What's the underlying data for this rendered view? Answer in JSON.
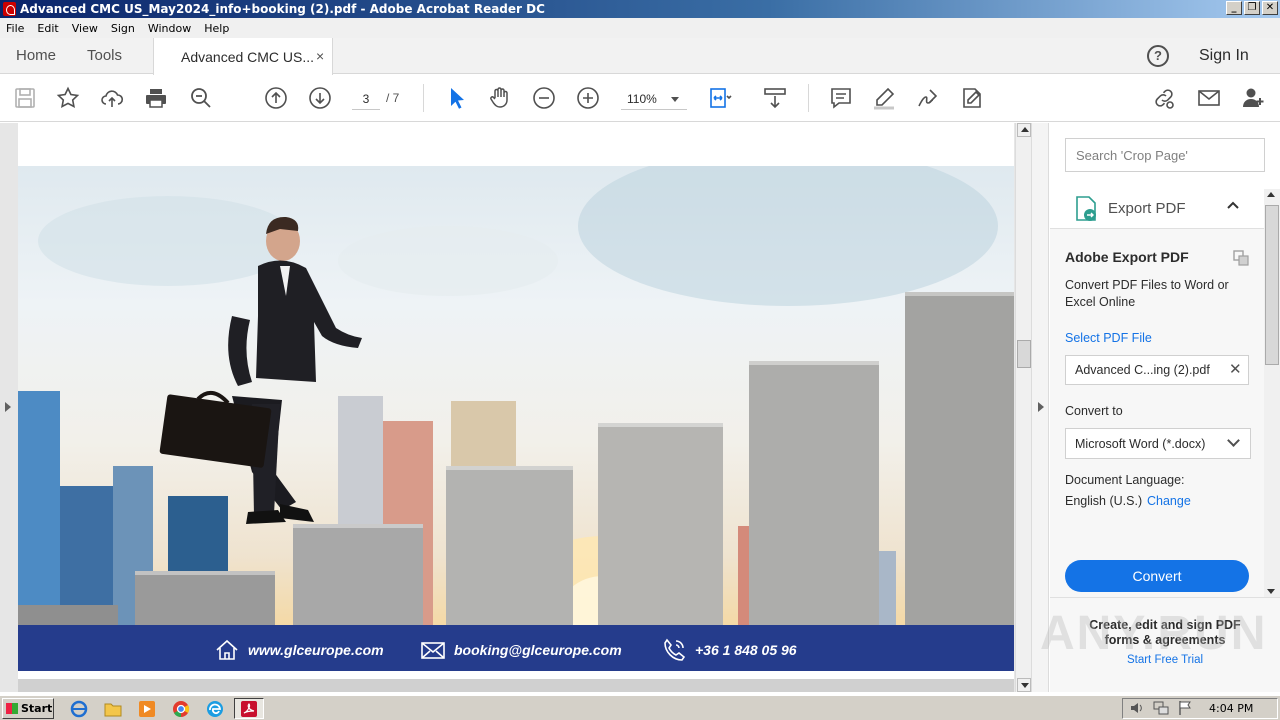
{
  "window": {
    "title": "Advanced CMC US_May2024_info+booking (2).pdf - Adobe Acrobat Reader DC",
    "controls": [
      "_",
      "❐",
      "✕"
    ]
  },
  "menu": [
    "File",
    "Edit",
    "View",
    "Sign",
    "Window",
    "Help"
  ],
  "tabs": {
    "home": "Home",
    "tools": "Tools",
    "document": "Advanced CMC US...",
    "close": "×"
  },
  "header": {
    "help": "?",
    "sign_in": "Sign In"
  },
  "toolbar": {
    "icons": [
      "save-icon",
      "star-icon",
      "upload-icon",
      "print-icon",
      "search-zoom-icon",
      "page-up-icon",
      "page-down-icon",
      "select-cursor-icon",
      "hand-icon",
      "zoom-out-icon",
      "zoom-in-icon",
      "fit-page-icon",
      "scroll-mode-icon",
      "comment-icon",
      "highlight-icon",
      "sign-icon",
      "edit-pdf-icon",
      "share-link-icon",
      "email-icon",
      "add-user-icon"
    ],
    "current_page": "3",
    "total_pages": "/ 7",
    "zoom": "110%"
  },
  "document": {
    "footer": {
      "website": "www.glceurope.com",
      "email": "booking@glceurope.com",
      "phone": "+36 1 848 05 96"
    },
    "colors": {
      "footer_band": "#253c8c"
    }
  },
  "right_pane": {
    "search_placeholder": "Search 'Crop Page'",
    "export_header": "Export PDF",
    "panel_title": "Adobe Export PDF",
    "description": "Convert PDF Files to Word or Excel Online",
    "select_label": "Select PDF File",
    "file_name": "Advanced C...ing (2).pdf",
    "file_clear": "✕",
    "convert_to_label": "Convert to",
    "format": "Microsoft Word (*.docx)",
    "language_label": "Document Language:",
    "language_value": "English (U.S.)",
    "change_link": "Change",
    "convert_button": "Convert",
    "promo_text": "Create, edit and sign PDF forms & agreements",
    "promo_link": "Start Free Trial",
    "accent": "#1473e6"
  },
  "watermark": "ANY.RUN",
  "taskbar": {
    "start": "Start",
    "clock": "4:04 PM"
  }
}
